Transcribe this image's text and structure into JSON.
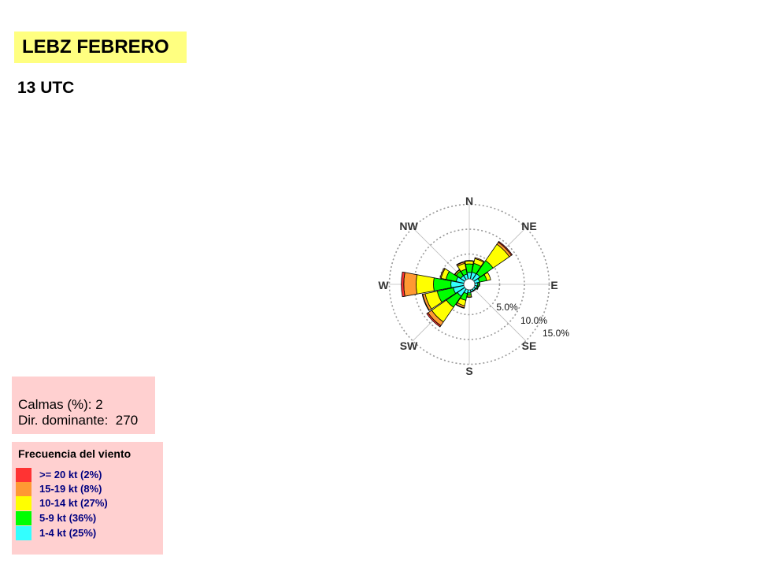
{
  "title": "LEBZ FEBRERO",
  "subtitle": "13 UTC",
  "stats": {
    "calm_text": "Calmas (%): 2",
    "dominant_text": "Dir. dominante:  270"
  },
  "legend": {
    "title": "Frecuencia del viento",
    "items": [
      {
        "label": ">= 20 kt (2%)",
        "color": "#ff3333"
      },
      {
        "label": "15-19 kt (8%)",
        "color": "#ff9933"
      },
      {
        "label": "10-14 kt (27%)",
        "color": "#ffff00"
      },
      {
        "label": "5-9 kt (36%)",
        "color": "#00ff00"
      },
      {
        "label": "1-4 kt (25%)",
        "color": "#33ffff"
      }
    ]
  },
  "chart_data": {
    "type": "wind-rose",
    "directions": [
      0,
      22.5,
      45,
      67.5,
      90,
      112.5,
      135,
      157.5,
      180,
      202.5,
      225,
      247.5,
      270,
      292.5,
      315,
      337.5
    ],
    "compass_labels": [
      "N",
      "NE",
      "E",
      "SE",
      "S",
      "SW",
      "W",
      "NW"
    ],
    "ring_labels": [
      "5.0%",
      "10.0%",
      "15.0%"
    ],
    "rings": [
      5,
      10,
      15
    ],
    "speed_bins": [
      "1-4 kt",
      "5-9 kt",
      "10-14 kt",
      "15-19 kt",
      ">= 20 kt"
    ],
    "series": [
      {
        "name": "1-4 kt",
        "color": "#33ffff",
        "values": [
          1.3,
          1.4,
          1.5,
          1.0,
          0.6,
          0.5,
          0.4,
          0.4,
          0.6,
          0.8,
          1.8,
          2.2,
          2.6,
          1.6,
          1.0,
          1.0
        ]
      },
      {
        "name": "5-9 kt",
        "color": "#00ff00",
        "values": [
          1.7,
          1.8,
          3.2,
          1.5,
          0.3,
          0.2,
          0.1,
          0.1,
          0.5,
          1.4,
          2.7,
          3.3,
          3.5,
          2.1,
          1.1,
          1.0
        ]
      },
      {
        "name": "10-14 kt",
        "color": "#ffff00",
        "values": [
          0.6,
          1.0,
          4.0,
          0.8,
          0.1,
          0.1,
          0.0,
          0.0,
          0.3,
          1.1,
          3.6,
          2.5,
          3.5,
          1.0,
          0.3,
          1.2
        ]
      },
      {
        "name": "15-19 kt",
        "color": "#ff9933",
        "values": [
          0.1,
          0.2,
          0.5,
          0.0,
          0.0,
          0.0,
          0.0,
          0.0,
          0.1,
          0.4,
          0.9,
          0.5,
          2.5,
          0.2,
          0.1,
          0.3
        ]
      },
      {
        "name": ">= 20 kt",
        "color": "#ff3333",
        "values": [
          0.0,
          0.0,
          0.2,
          0.0,
          0.0,
          0.0,
          0.0,
          0.0,
          0.0,
          0.1,
          0.3,
          0.1,
          0.5,
          0.0,
          0.0,
          0.1
        ]
      }
    ],
    "calms_percent": 2,
    "dominant_direction": 270
  }
}
